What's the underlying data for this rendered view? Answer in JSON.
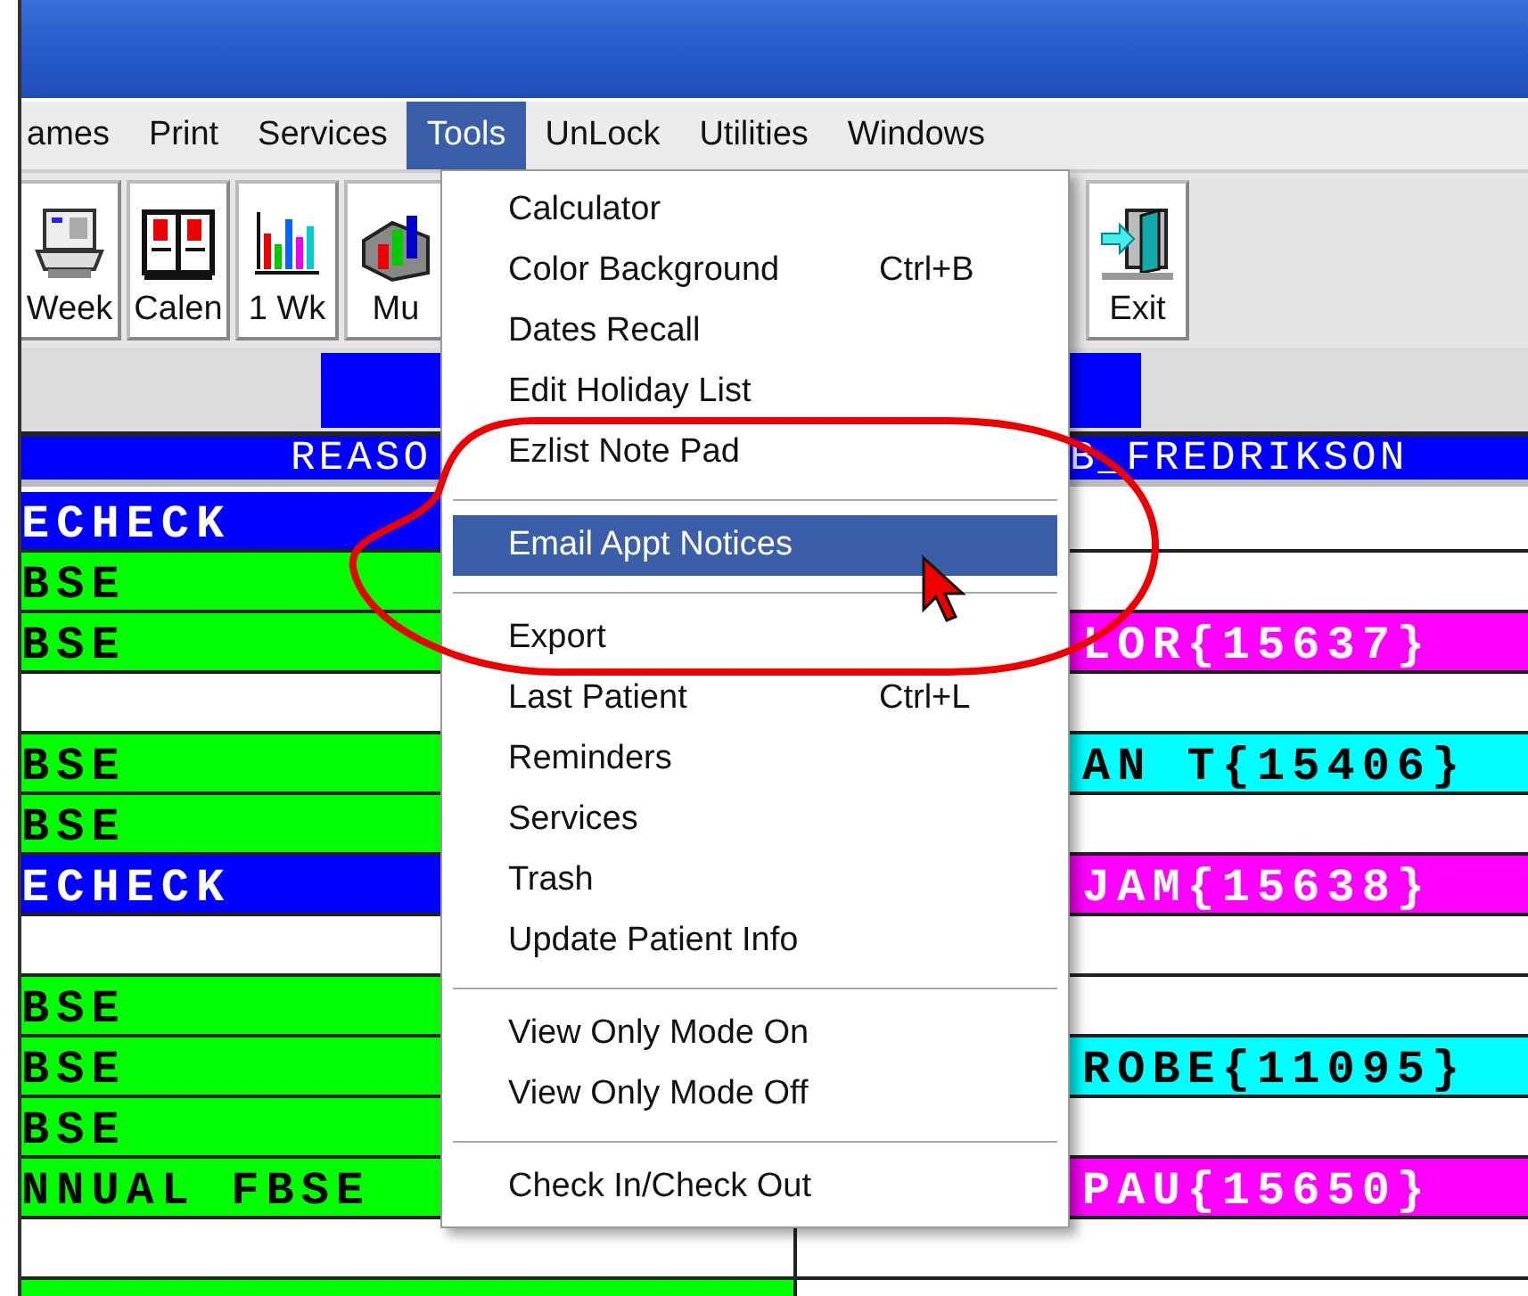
{
  "menubar": {
    "items": [
      {
        "label": "ames",
        "selected": false
      },
      {
        "label": "Print",
        "selected": false
      },
      {
        "label": "Services",
        "selected": false
      },
      {
        "label": "Tools",
        "selected": true
      },
      {
        "label": "UnLock",
        "selected": false
      },
      {
        "label": "Utilities",
        "selected": false
      },
      {
        "label": "Windows",
        "selected": false
      }
    ]
  },
  "toolbar": {
    "buttons": [
      {
        "kind": "week",
        "label": "Week"
      },
      {
        "kind": "calendar",
        "label": "Calen"
      },
      {
        "kind": "chart",
        "label": "1 Wk"
      },
      {
        "kind": "multi",
        "label": "Mu"
      },
      {
        "kind": "exit",
        "label": "Exit"
      }
    ]
  },
  "schedule": {
    "columns": [
      "REASO",
      "B_FREDRIKSON"
    ],
    "rows": [
      {
        "reason": {
          "text": "ECHECK",
          "color": "#0000ff"
        },
        "provider": {
          "color": "#ffffff"
        }
      },
      {
        "reason": {
          "text": "BSE",
          "color": "#00ff00"
        },
        "provider": {
          "color": "#ffffff"
        }
      },
      {
        "reason": {
          "text": "BSE",
          "color": "#00ff00"
        },
        "provider": {
          "text": "LOR{15637}",
          "color": "#ff00ff"
        }
      },
      {
        "reason": {
          "color": "#ffffff"
        },
        "provider": {
          "color": "#ffffff"
        }
      },
      {
        "reason": {
          "text": "BSE",
          "color": "#00ff00"
        },
        "provider": {
          "text": "AN T{15406}",
          "color": "#00ffff"
        }
      },
      {
        "reason": {
          "text": "BSE",
          "color": "#00ff00"
        },
        "provider": {
          "color": "#ffffff"
        }
      },
      {
        "reason": {
          "text": "ECHECK",
          "color": "#0000ff"
        },
        "provider": {
          "text": "JAM{15638}",
          "color": "#ff00ff"
        }
      },
      {
        "reason": {
          "color": "#ffffff"
        },
        "provider": {
          "color": "#ffffff"
        }
      },
      {
        "reason": {
          "text": "BSE",
          "color": "#00ff00"
        },
        "provider": {
          "color": "#ffffff"
        }
      },
      {
        "reason": {
          "text": "BSE",
          "color": "#00ff00"
        },
        "provider": {
          "text": "ROBE{11095}",
          "color": "#00ffff"
        }
      },
      {
        "reason": {
          "text": "BSE",
          "color": "#00ff00"
        },
        "provider": {
          "color": "#ffffff"
        }
      },
      {
        "reason": {
          "text": "NNUAL FBSE",
          "color": "#00ff00"
        },
        "provider": {
          "text": "PAU{15650}",
          "color": "#ff00ff"
        }
      },
      {
        "reason": {
          "color": "#ffffff"
        },
        "provider": {
          "color": "#ffffff"
        }
      },
      {
        "reason": {
          "color": "#00ff00"
        },
        "provider": {
          "color": "#ffffff"
        }
      }
    ]
  },
  "tools_menu": {
    "items": [
      {
        "kind": "item",
        "label": "Calculator",
        "selected": false
      },
      {
        "kind": "item",
        "label": "Color Background",
        "shortcut": "Ctrl+B",
        "selected": false
      },
      {
        "kind": "item",
        "label": "Dates Recall",
        "selected": false
      },
      {
        "kind": "item",
        "label": "Edit Holiday List",
        "selected": false
      },
      {
        "kind": "item",
        "label": "Ezlist Note Pad",
        "selected": false
      },
      {
        "kind": "separator"
      },
      {
        "kind": "item",
        "label": "Email Appt Notices",
        "selected": true
      },
      {
        "kind": "separator"
      },
      {
        "kind": "item",
        "label": "Export",
        "selected": false
      },
      {
        "kind": "item",
        "label": "Last Patient",
        "shortcut": "Ctrl+L",
        "selected": false
      },
      {
        "kind": "item",
        "label": "Reminders",
        "selected": false
      },
      {
        "kind": "item",
        "label": "Services",
        "selected": false
      },
      {
        "kind": "item",
        "label": "Trash",
        "selected": false
      },
      {
        "kind": "item",
        "label": "Update Patient Info",
        "selected": false
      },
      {
        "kind": "separator"
      },
      {
        "kind": "item",
        "label": "View Only Mode On",
        "selected": false
      },
      {
        "kind": "item",
        "label": "View Only Mode Off",
        "selected": false
      },
      {
        "kind": "separator"
      },
      {
        "kind": "item",
        "label": "Check In/Check Out",
        "selected": false
      }
    ]
  }
}
